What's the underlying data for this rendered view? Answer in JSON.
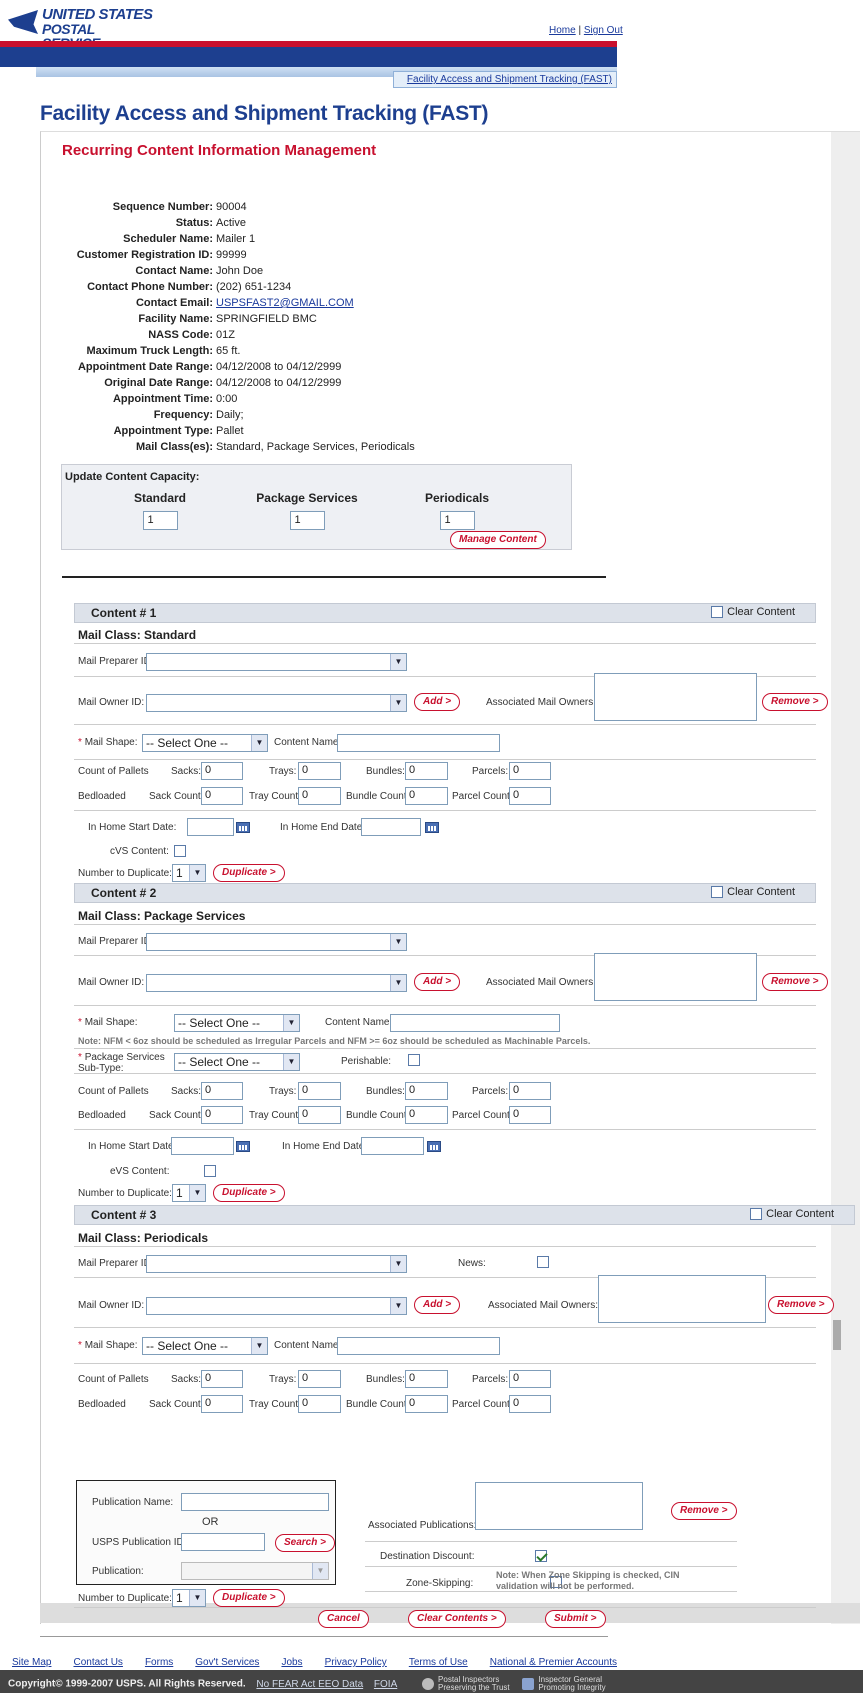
{
  "header": {
    "logo_line1": "UNITED STATES",
    "logo_line2": "POSTAL SERVICE",
    "logo_reg": "®",
    "home": "Home",
    "sep": "|",
    "signout": "Sign Out",
    "fast_link": "Facility Access and Shipment Tracking (FAST)"
  },
  "title": "Facility Access and Shipment Tracking (FAST)",
  "subtitle": "Recurring Content Information Management",
  "info": [
    {
      "label": "Sequence Number:",
      "value": "90004"
    },
    {
      "label": "Status:",
      "value": "Active"
    },
    {
      "label": "Scheduler Name:",
      "value": "Mailer 1"
    },
    {
      "label": "Customer Registration ID:",
      "value": "99999"
    },
    {
      "label": "Contact Name:",
      "value": "John Doe"
    },
    {
      "label": "Contact Phone Number:",
      "value": "(202) 651-1234"
    },
    {
      "label": "Contact Email:",
      "value": "USPSFAST2@GMAIL.COM"
    },
    {
      "label": "Facility Name:",
      "value": "SPRINGFIELD BMC"
    },
    {
      "label": "NASS Code:",
      "value": "01Z"
    },
    {
      "label": "Maximum Truck Length:",
      "value": "65 ft."
    },
    {
      "label": "Appointment Date Range:",
      "value": "04/12/2008 to 04/12/2999"
    },
    {
      "label": "Original Date Range:",
      "value": "04/12/2008 to 04/12/2999"
    },
    {
      "label": "Appointment Time:",
      "value": "0:00"
    },
    {
      "label": "Frequency:",
      "value": "Daily;"
    },
    {
      "label": "Appointment Type:",
      "value": "Pallet"
    },
    {
      "label": "Mail Class(es):",
      "value": "Standard, Package Services, Periodicals"
    }
  ],
  "capacity": {
    "title": "Update Content Capacity:",
    "standard": "Standard",
    "package": "Package Services",
    "periodicals": "Periodicals",
    "standard_val": "1",
    "package_val": "1",
    "periodicals_val": "1",
    "manage": "Manage Content"
  },
  "labels": {
    "clear": "Clear Content",
    "preparer": "Mail Preparer ID:",
    "owner": "Mail Owner ID:",
    "add": "Add >",
    "assoc_owners": "Associated Mail Owners:",
    "remove": "Remove >",
    "req": "*",
    "shape": "Mail Shape:",
    "select_one": "-- Select One --",
    "content_name": "Content Name:",
    "count_pallets": "Count of Pallets",
    "sacks": "Sacks:",
    "trays": "Trays:",
    "bundles": "Bundles:",
    "parcels": "Parcels:",
    "bedloaded": "Bedloaded",
    "sack_count": "Sack Count:",
    "tray_count": "Tray Count:",
    "bundle_count": "Bundle Count:",
    "parcel_count": "Parcel Count:",
    "start": "In Home Start Date:",
    "end": "In Home End Date:",
    "cvs": "cVS Content:",
    "evs": "eVS Content:",
    "dup_num": "Number to Duplicate:",
    "dup_val": "1",
    "duplicate": "Duplicate >",
    "zero": "0",
    "news": "News:",
    "nfm_note": "Note: NFM < 6oz should be scheduled as Irregular Parcels and NFM >= 6oz should be scheduled as Machinable Parcels.",
    "pkg_sub1": "Package Services",
    "pkg_sub2": "Sub-Type:",
    "perishable": "Perishable:",
    "pub_name": "Publication Name:",
    "or": "OR",
    "usps_pub": "USPS Publication ID:",
    "search": "Search >",
    "publication": "Publication:",
    "assoc_pubs": "Associated Publications:",
    "dest_discount": "Destination Discount:",
    "zone_skip": "Zone-Skipping:",
    "zone_note1": "Note: When Zone Skipping is checked, CIN",
    "zone_note2": "validation will not be performed.",
    "cancel": "Cancel",
    "clear_contents": "Clear Contents >",
    "submit": "Submit >"
  },
  "contents": [
    {
      "title": "Content # 1",
      "mail_class": "Mail Class: Standard"
    },
    {
      "title": "Content # 2",
      "mail_class": "Mail Class: Package Services"
    },
    {
      "title": "Content # 3",
      "mail_class": "Mail Class: Periodicals"
    }
  ],
  "footer": {
    "links": [
      "Site Map",
      "Contact Us",
      "Forms",
      "Gov't Services",
      "Jobs",
      "Privacy Policy",
      "Terms of Use",
      "National & Premier Accounts"
    ],
    "copyright": "Copyright© 1999-2007 USPS. All Rights Reserved.",
    "nofear": "No FEAR Act EEO Data",
    "foia": "FOIA",
    "badge1a": "Postal Inspectors",
    "badge1b": "Preserving the Trust",
    "badge2a": "Inspector General",
    "badge2b": "Promoting Integrity"
  }
}
